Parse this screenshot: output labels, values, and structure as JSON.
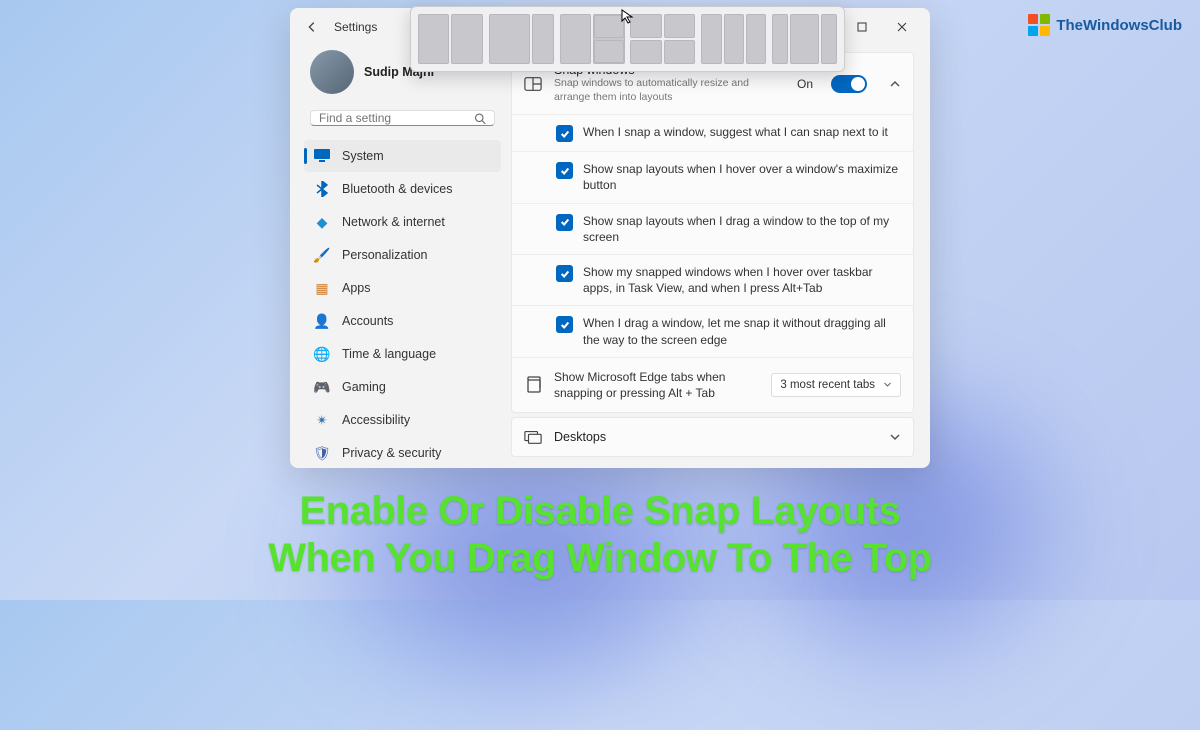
{
  "app_title": "Settings",
  "profile": {
    "name": "Sudip Majhi"
  },
  "search": {
    "placeholder": "Find a setting"
  },
  "nav": [
    {
      "label": "System",
      "icon": "💻"
    },
    {
      "label": "Bluetooth & devices",
      "icon": "bt"
    },
    {
      "label": "Network & internet",
      "icon": "📶"
    },
    {
      "label": "Personalization",
      "icon": "🖌️"
    },
    {
      "label": "Apps",
      "icon": "📦"
    },
    {
      "label": "Accounts",
      "icon": "👤"
    },
    {
      "label": "Time & language",
      "icon": "🕐"
    },
    {
      "label": "Gaming",
      "icon": "🎮"
    },
    {
      "label": "Accessibility",
      "icon": "♿"
    },
    {
      "label": "Privacy & security",
      "icon": "🛡️"
    }
  ],
  "snap": {
    "title": "Snap windows",
    "subtitle": "Snap windows to automatically resize and arrange them into layouts",
    "state_label": "On",
    "options": [
      "When I snap a window, suggest what I can snap next to it",
      "Show snap layouts when I hover over a window's maximize button",
      "Show snap layouts when I drag a window to the top of my screen",
      "Show my snapped windows when I hover over taskbar apps, in Task View, and when I press Alt+Tab",
      "When I drag a window, let me snap it without dragging all the way to the screen edge"
    ]
  },
  "edge_tabs": {
    "label": "Show Microsoft Edge tabs when snapping or pressing Alt + Tab",
    "value": "3 most recent tabs"
  },
  "desktops": {
    "label": "Desktops"
  },
  "watermark": "TheWindowsClub",
  "caption_line1": "Enable Or Disable Snap Layouts",
  "caption_line2": "When You Drag Window To The Top"
}
